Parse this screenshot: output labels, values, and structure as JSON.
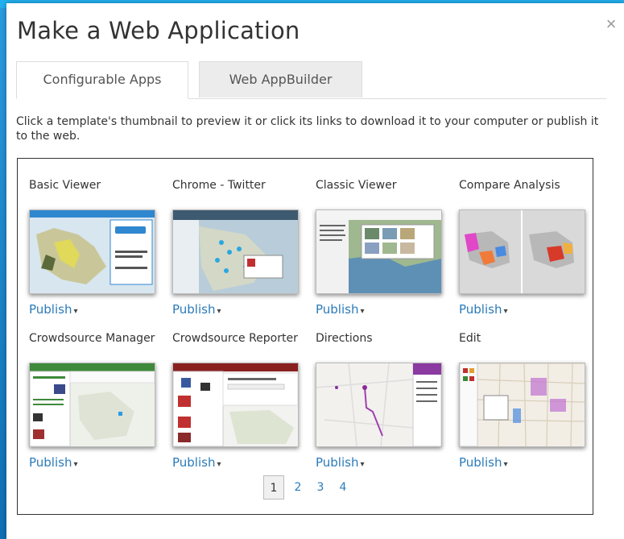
{
  "dialog": {
    "title": "Make a Web Application",
    "close_glyph": "×"
  },
  "tabs": [
    {
      "label": "Configurable Apps",
      "active": true
    },
    {
      "label": "Web AppBuilder",
      "active": false
    }
  ],
  "instructions": "Click a template's thumbnail to preview it or click its links to download it to your computer or publish it to the web.",
  "templates": [
    {
      "title": "Basic Viewer",
      "action": "Publish"
    },
    {
      "title": "Chrome - Twitter",
      "action": "Publish"
    },
    {
      "title": "Classic Viewer",
      "action": "Publish"
    },
    {
      "title": "Compare Analysis",
      "action": "Publish"
    },
    {
      "title": "Crowdsource Manager",
      "action": "Publish"
    },
    {
      "title": "Crowdsource Reporter",
      "action": "Publish"
    },
    {
      "title": "Directions",
      "action": "Publish"
    },
    {
      "title": "Edit",
      "action": "Publish"
    }
  ],
  "dropdown_glyph": "▾",
  "pagination": {
    "pages": [
      "1",
      "2",
      "3",
      "4"
    ],
    "current": "1"
  },
  "colors": {
    "link": "#2b7bb9",
    "background": "#1a8fd4"
  }
}
